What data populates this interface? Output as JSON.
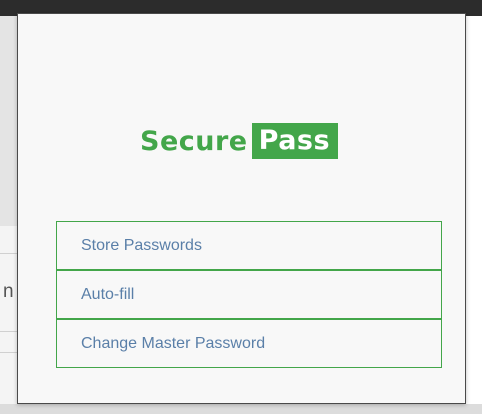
{
  "brand": {
    "name_first": "Secure",
    "name_second": "Pass",
    "accent_color": "#43a64a"
  },
  "background": {
    "partial_letter": "n"
  },
  "menu": {
    "items": [
      {
        "label": "Store Passwords"
      },
      {
        "label": "Auto-fill"
      },
      {
        "label": "Change Master Password"
      }
    ],
    "text_color": "#5a7fa8"
  }
}
